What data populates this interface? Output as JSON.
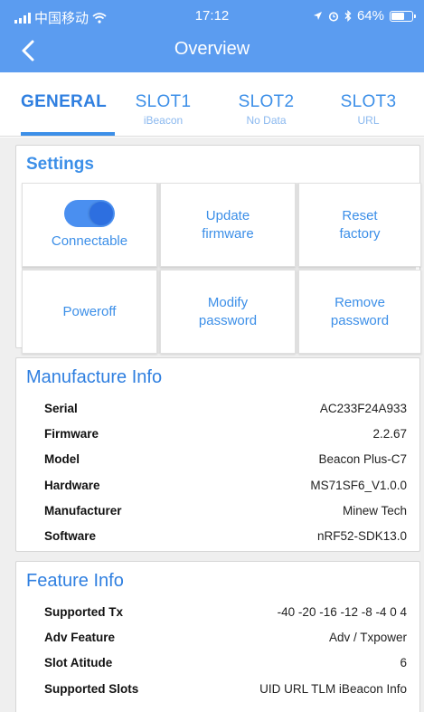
{
  "status_bar": {
    "carrier": "中国移动",
    "time": "17:12",
    "battery": "64%",
    "battery_level": 0.64
  },
  "nav": {
    "title": "Overview"
  },
  "tabs": [
    {
      "label": "GENERAL",
      "sub": ""
    },
    {
      "label": "SLOT1",
      "sub": "iBeacon"
    },
    {
      "label": "SLOT2",
      "sub": "No Data"
    },
    {
      "label": "SLOT3",
      "sub": "URL"
    }
  ],
  "settings": {
    "title": "Settings",
    "connectable_label": "Connectable",
    "connectable_on": true,
    "update_firmware": "Update\nfirmware",
    "reset_factory": "Reset\nfactory",
    "poweroff": "Poweroff",
    "modify_password": "Modify\npassword",
    "remove_password": "Remove\npassword"
  },
  "manufacture_info": {
    "title": "Manufacture Info",
    "rows": [
      {
        "label": "Serial",
        "value": "AC233F24A933"
      },
      {
        "label": "Firmware",
        "value": "2.2.67"
      },
      {
        "label": "Model",
        "value": "Beacon Plus-C7"
      },
      {
        "label": "Hardware",
        "value": "MS71SF6_V1.0.0"
      },
      {
        "label": "Manufacturer",
        "value": "Minew Tech"
      },
      {
        "label": "Software",
        "value": "nRF52-SDK13.0"
      }
    ]
  },
  "feature_info": {
    "title": "Feature Info",
    "rows": [
      {
        "label": "Supported Tx",
        "value": "-40 -20 -16 -12 -8 -4 0 4"
      },
      {
        "label": "Adv Feature",
        "value": "Adv / Txpower"
      },
      {
        "label": "Slot Atitude",
        "value": "6"
      },
      {
        "label": "Supported Slots",
        "value": "UID URL TLM iBeacon Info"
      }
    ]
  },
  "colors": {
    "header": "#5b9cf0",
    "accent": "#3c8fe8",
    "background": "#efefef"
  }
}
